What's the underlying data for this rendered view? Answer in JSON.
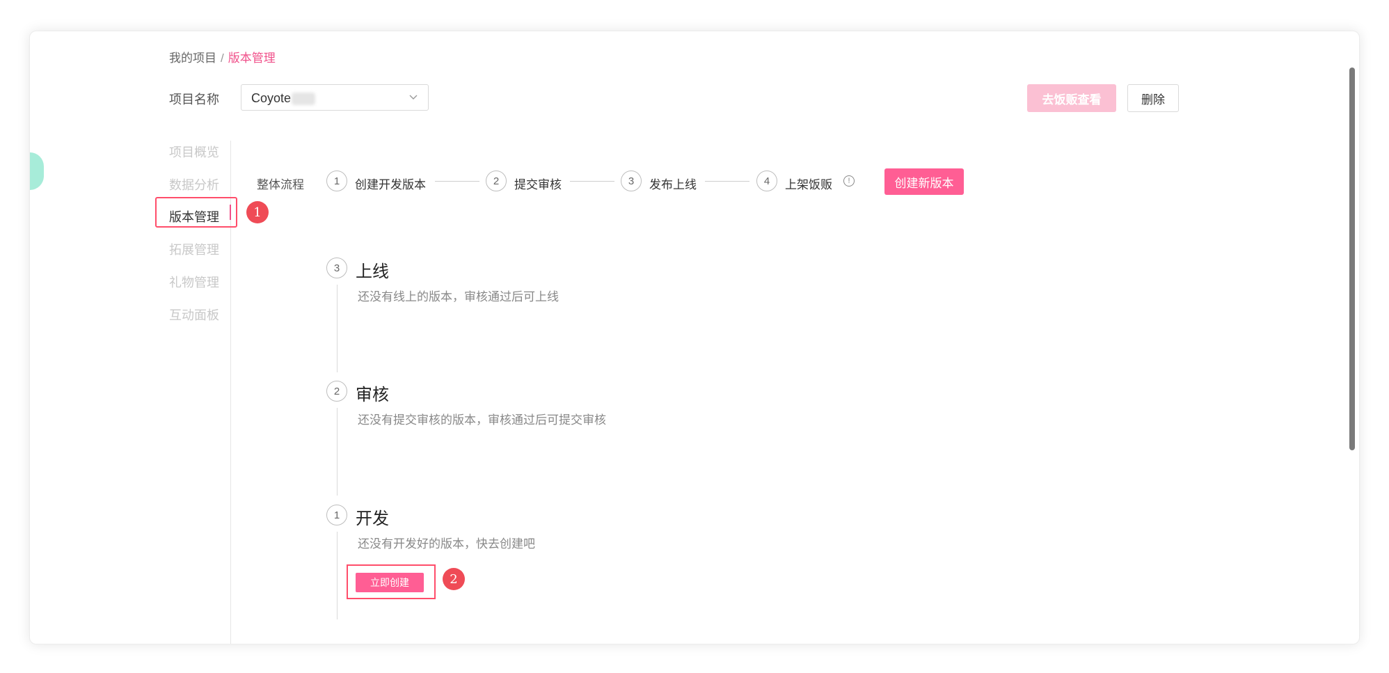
{
  "breadcrumb": {
    "parent": "我的项目",
    "separator": "/",
    "current": "版本管理"
  },
  "project": {
    "label": "项目名称",
    "selected": "Coyote"
  },
  "header_buttons": {
    "view": "去饭贩查看",
    "delete": "删除"
  },
  "sidebar": {
    "items": [
      {
        "label": "项目概览",
        "active": false
      },
      {
        "label": "数据分析",
        "active": false
      },
      {
        "label": "版本管理",
        "active": true
      },
      {
        "label": "拓展管理",
        "active": false
      },
      {
        "label": "礼物管理",
        "active": false
      },
      {
        "label": "互动面板",
        "active": false
      }
    ]
  },
  "flow": {
    "label": "整体流程",
    "steps": [
      {
        "num": "1",
        "label": "创建开发版本"
      },
      {
        "num": "2",
        "label": "提交审核"
      },
      {
        "num": "3",
        "label": "发布上线"
      },
      {
        "num": "4",
        "label": "上架饭贩"
      }
    ],
    "info_icon": "info-icon",
    "create_button": "创建新版本"
  },
  "stages": [
    {
      "num": "3",
      "title": "上线",
      "desc": "还没有线上的版本，审核通过后可上线"
    },
    {
      "num": "2",
      "title": "审核",
      "desc": "还没有提交审核的版本，审核通过后可提交审核"
    },
    {
      "num": "1",
      "title": "开发",
      "desc": "还没有开发好的版本，快去创建吧",
      "button": "立即创建"
    }
  ],
  "annotations": {
    "badge1": "1",
    "badge2": "2"
  },
  "colors": {
    "accent": "#f0508a",
    "button_pink": "#ff5e94",
    "annotation_red": "#ef4b56",
    "disabled_pink": "#fbc0d3"
  }
}
